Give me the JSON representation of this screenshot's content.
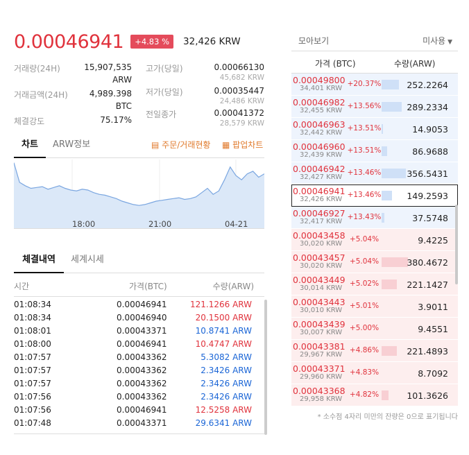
{
  "ticker": {
    "price": "0.00046941",
    "change_pct": "+4.83 %",
    "krw_price": "32,426 KRW"
  },
  "stats": {
    "volume_label": "거래량(24H)",
    "volume_value": "15,907,535",
    "volume_unit": "ARW",
    "amount_label": "거래금액(24H)",
    "amount_value": "4,989.398",
    "amount_unit": "BTC",
    "strength_label": "체결강도",
    "strength_value": "75.17%",
    "high_label": "고가(당일)",
    "high_value": "0.00066130",
    "high_krw": "45,682 KRW",
    "low_label": "저가(당일)",
    "low_value": "0.00035447",
    "low_krw": "24,486 KRW",
    "prev_label": "전일종가",
    "prev_value": "0.00041372",
    "prev_krw": "28,579 KRW"
  },
  "chart_tabs": {
    "chart": "차트",
    "info": "ARW정보",
    "orders": "주문/거래현황",
    "popup": "팝업차트"
  },
  "chart_data": {
    "type": "area",
    "x_ticks": [
      "18:00",
      "21:00",
      "04-21"
    ],
    "y": [
      0.000475,
      0.000452,
      0.000448,
      0.000445,
      0.000446,
      0.000447,
      0.000444,
      0.000446,
      0.000448,
      0.000445,
      0.000443,
      0.000442,
      0.000444,
      0.000443,
      0.00044,
      0.000438,
      0.000437,
      0.000435,
      0.000433,
      0.00043,
      0.000428,
      0.000426,
      0.000425,
      0.000426,
      0.000428,
      0.00043,
      0.000431,
      0.000432,
      0.000433,
      0.000434,
      0.000432,
      0.000433,
      0.000435,
      0.00044,
      0.000445,
      0.000438,
      0.000442,
      0.000455,
      0.00047,
      0.00046,
      0.000455,
      0.000462,
      0.000465,
      0.000458,
      0.000462
    ],
    "color": "#7aa6e0",
    "fill": "#dbe8f8"
  },
  "trades": {
    "tab_active": "체결내역",
    "tab_other": "세계시세",
    "col_time": "시간",
    "col_price": "가격(BTC)",
    "col_qty": "수량(ARW)",
    "rows": [
      {
        "time": "01:08:34",
        "price": "0.00046941",
        "qty": "121.1266 ARW",
        "side": "buy"
      },
      {
        "time": "01:08:34",
        "price": "0.00046940",
        "qty": "20.1500 ARW",
        "side": "buy"
      },
      {
        "time": "01:08:01",
        "price": "0.00043371",
        "qty": "10.8741 ARW",
        "side": "sell"
      },
      {
        "time": "01:08:00",
        "price": "0.00046941",
        "qty": "10.4747 ARW",
        "side": "buy"
      },
      {
        "time": "01:07:57",
        "price": "0.00043362",
        "qty": "5.3082 ARW",
        "side": "sell"
      },
      {
        "time": "01:07:57",
        "price": "0.00043362",
        "qty": "2.3426 ARW",
        "side": "sell"
      },
      {
        "time": "01:07:57",
        "price": "0.00043362",
        "qty": "2.3426 ARW",
        "side": "sell"
      },
      {
        "time": "01:07:56",
        "price": "0.00043362",
        "qty": "2.3426 ARW",
        "side": "sell"
      },
      {
        "time": "01:07:56",
        "price": "0.00046941",
        "qty": "12.5258 ARW",
        "side": "buy"
      },
      {
        "time": "01:07:48",
        "price": "0.00043371",
        "qty": "29.6341 ARW",
        "side": "sell"
      }
    ]
  },
  "orderbook": {
    "view_all": "모아보기",
    "filter": "미사용",
    "col_price": "가격 (BTC)",
    "col_qty": "수량(ARW)",
    "footnote": "* 소수점 4자리 미만의 잔량은 0으로 표기됩니다",
    "rows": [
      {
        "price": "0.00049800",
        "krw": "34,401 KRW",
        "pct": "+20.37%",
        "qty": "252.2264",
        "side": "sell",
        "bar": 0.33
      },
      {
        "price": "0.00046982",
        "krw": "32,455 KRW",
        "pct": "+13.56%",
        "qty": "289.2334",
        "side": "sell",
        "bar": 0.38
      },
      {
        "price": "0.00046963",
        "krw": "32,442 KRW",
        "pct": "+13.51%",
        "qty": "14.9053",
        "side": "sell",
        "bar": 0.02
      },
      {
        "price": "0.00046960",
        "krw": "32,439 KRW",
        "pct": "+13.51%",
        "qty": "86.9688",
        "side": "sell",
        "bar": 0.11
      },
      {
        "price": "0.00046942",
        "krw": "32,427 KRW",
        "pct": "+13.46%",
        "qty": "356.5431",
        "side": "sell",
        "bar": 0.47
      },
      {
        "price": "0.00046941",
        "krw": "32,426 KRW",
        "pct": "+13.46%",
        "qty": "149.2593",
        "side": "sell",
        "bar": 0.2,
        "current": true
      },
      {
        "price": "0.00046927",
        "krw": "32,417 KRW",
        "pct": "+13.43%",
        "qty": "37.5748",
        "side": "sell",
        "bar": 0.05
      },
      {
        "price": "0.00043458",
        "krw": "30,020 KRW",
        "pct": "+5.04%",
        "qty": "9.4225",
        "side": "buy",
        "bar": 0.0
      },
      {
        "price": "0.00043457",
        "krw": "30,020 KRW",
        "pct": "+5.04%",
        "qty": "380.4672",
        "side": "buy",
        "bar": 0.5
      },
      {
        "price": "0.00043449",
        "krw": "30,014 KRW",
        "pct": "+5.02%",
        "qty": "221.1427",
        "side": "buy",
        "bar": 0.29
      },
      {
        "price": "0.00043443",
        "krw": "30,010 KRW",
        "pct": "+5.01%",
        "qty": "3.9011",
        "side": "buy",
        "bar": 0.0
      },
      {
        "price": "0.00043439",
        "krw": "30,007 KRW",
        "pct": "+5.00%",
        "qty": "9.4551",
        "side": "buy",
        "bar": 0.0
      },
      {
        "price": "0.00043381",
        "krw": "29,967 KRW",
        "pct": "+4.86%",
        "qty": "221.4893",
        "side": "buy",
        "bar": 0.29
      },
      {
        "price": "0.00043371",
        "krw": "29,960 KRW",
        "pct": "+4.83%",
        "qty": "8.7092",
        "side": "buy",
        "bar": 0.0
      },
      {
        "price": "0.00043368",
        "krw": "29,958 KRW",
        "pct": "+4.82%",
        "qty": "101.3626",
        "side": "buy",
        "bar": 0.13
      }
    ]
  }
}
